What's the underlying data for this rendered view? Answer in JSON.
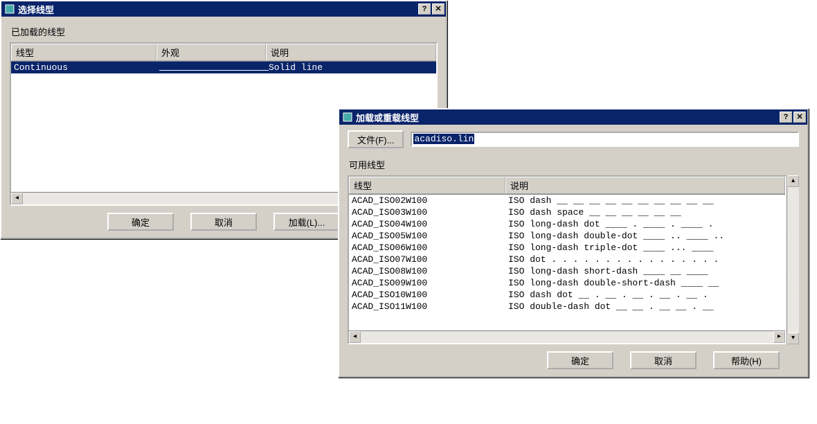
{
  "dlg1": {
    "title": "选择线型",
    "loadedLabel": "已加载的线型",
    "columns": {
      "linetype": "线型",
      "appearance": "外观",
      "description": "说明"
    },
    "rows": [
      {
        "name": "Continuous",
        "description": "Solid line"
      }
    ],
    "buttons": {
      "ok": "确定",
      "cancel": "取消",
      "load": "加载(L)..."
    }
  },
  "dlg2": {
    "title": "加载或重载线型",
    "fileBtn": "文件(F)...",
    "filename": "acadiso.lin",
    "availableLabel": "可用线型",
    "columns": {
      "linetype": "线型",
      "description": "说明"
    },
    "rows": [
      {
        "name": "ACAD_ISO02W100",
        "description": "ISO dash __ __ __ __ __ __ __ __ __ __"
      },
      {
        "name": "ACAD_ISO03W100",
        "description": "ISO dash space __  __  __  __  __  __"
      },
      {
        "name": "ACAD_ISO04W100",
        "description": "ISO long-dash dot ____ . ____ . ____ ."
      },
      {
        "name": "ACAD_ISO05W100",
        "description": "ISO long-dash double-dot ____ .. ____ .."
      },
      {
        "name": "ACAD_ISO06W100",
        "description": "ISO long-dash triple-dot ____ ... ____"
      },
      {
        "name": "ACAD_ISO07W100",
        "description": "ISO dot . . . . . . . . . . . . . . . ."
      },
      {
        "name": "ACAD_ISO08W100",
        "description": "ISO long-dash short-dash ____ __ ____"
      },
      {
        "name": "ACAD_ISO09W100",
        "description": "ISO long-dash double-short-dash ____ __"
      },
      {
        "name": "ACAD_ISO10W100",
        "description": "ISO dash dot __ . __ . __ . __ . __ ."
      },
      {
        "name": "ACAD_ISO11W100",
        "description": "ISO double-dash dot __ __ . __ __ . __"
      }
    ],
    "buttons": {
      "ok": "确定",
      "cancel": "取消",
      "help": "帮助(H)"
    }
  }
}
